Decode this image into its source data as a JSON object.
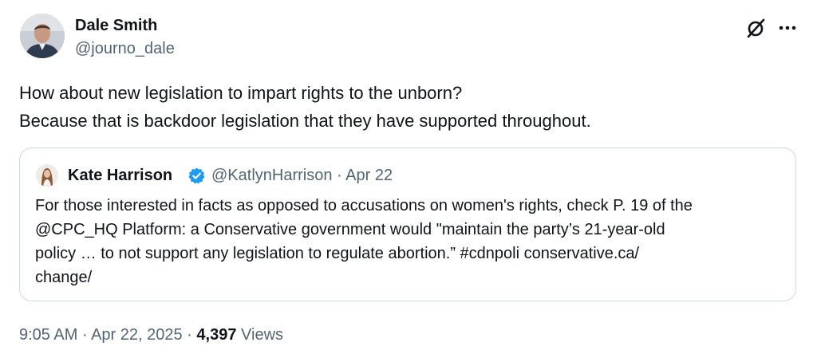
{
  "author": {
    "name": "Dale Smith",
    "handle": "@journo_dale"
  },
  "tweet": {
    "lines": [
      "How about new legislation to impart rights to the unborn?",
      "Because that is backdoor legislation that they have supported throughout."
    ]
  },
  "quoted": {
    "name": "Kate Harrison",
    "handle": "@KatlynHarrison",
    "separator": "·",
    "date": "Apr 22",
    "lines": [
      "For those interested in facts as opposed to accusations on women's rights, check P. 19 of the",
      "@CPC_HQ Platform: a Conservative government would \"maintain the party’s 21-year-old",
      "policy … to not support any legislation to regulate abortion.” #cdnpoli conservative.ca/",
      "change/"
    ],
    "verified_color": "#1d9bf0"
  },
  "footer": {
    "time": "9:05 AM",
    "sep1": "·",
    "date": "Apr 22, 2025",
    "sep2": "·",
    "views_count": "4,397",
    "views_label": "Views"
  },
  "icons": {
    "grok": "grok-icon",
    "more": "more-icon",
    "verified": "verified-badge-icon"
  },
  "colors": {
    "text_primary": "#0f1419",
    "text_secondary": "#536471",
    "border": "#cfd9de"
  }
}
